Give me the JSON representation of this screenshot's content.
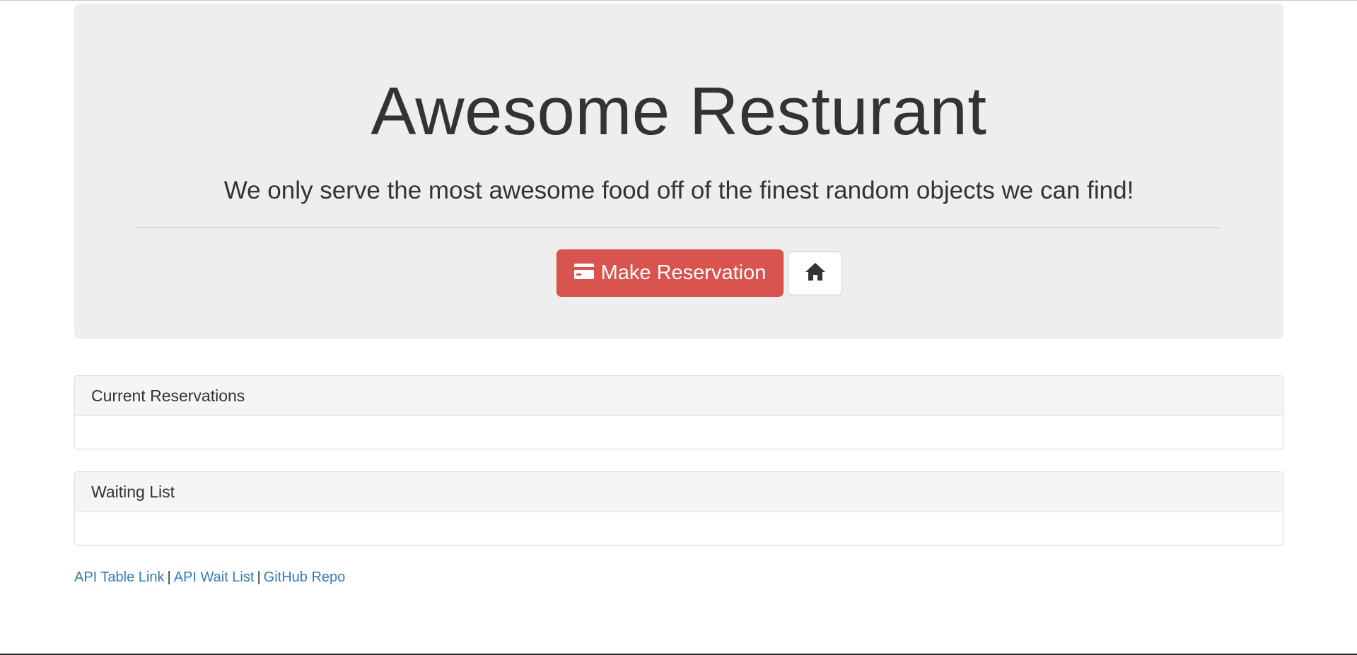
{
  "header": {
    "title": "Awesome Resturant",
    "tagline": "We only serve the most awesome food off of the finest random objects we can find!"
  },
  "actions": {
    "reserve_label": "Make Reservation",
    "reserve_icon": "credit-card-icon",
    "home_icon": "home-icon",
    "reserve_color": "#d9534f"
  },
  "panels": {
    "reservations_title": "Current Reservations",
    "waitlist_title": "Waiting List"
  },
  "footer": {
    "links": [
      {
        "label": "API Table Link"
      },
      {
        "label": "API Wait List"
      },
      {
        "label": "GitHub Repo"
      }
    ],
    "separator": "|",
    "link_color": "#337ab7"
  }
}
